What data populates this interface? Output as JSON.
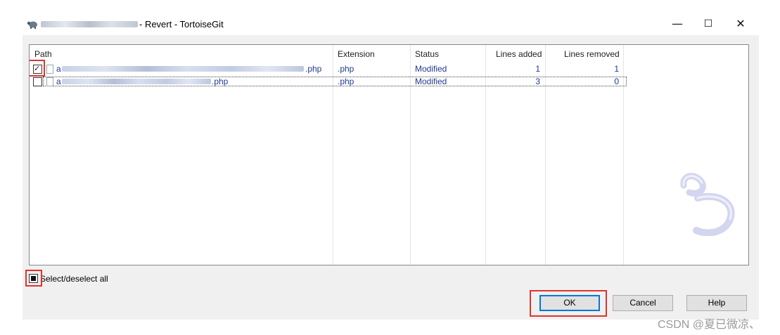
{
  "window": {
    "title_suffix": "- Revert - TortoiseGit",
    "minimize": "—",
    "maximize": "☐",
    "close": "✕"
  },
  "table": {
    "columns": [
      "Path",
      "Extension",
      "Status",
      "Lines added",
      "Lines removed"
    ],
    "rows": [
      {
        "checked": true,
        "path_prefix": "a",
        "path_suffix": ".php",
        "extension": ".php",
        "status": "Modified",
        "lines_added": "1",
        "lines_removed": "1"
      },
      {
        "checked": false,
        "path_prefix": "a",
        "path_suffix": ".php",
        "extension": ".php",
        "status": "Modified",
        "lines_added": "3",
        "lines_removed": "0"
      }
    ]
  },
  "select_all": {
    "label": "Select/deselect all",
    "state": "indeterminate"
  },
  "buttons": {
    "ok": "OK",
    "cancel": "Cancel",
    "help": "Help"
  },
  "watermark": "CSDN @夏已微凉、",
  "icons": {
    "app": "tortoisegit-app-icon",
    "watermark_logo": "tortoisegit-swirl-logo",
    "file": "file-icon"
  }
}
